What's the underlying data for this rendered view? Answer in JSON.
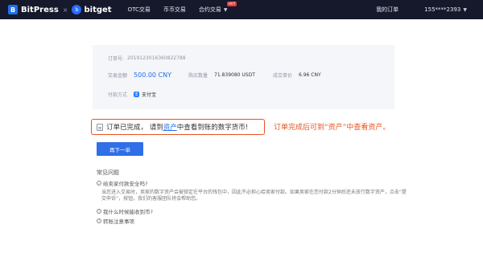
{
  "header": {
    "brand_bitpress": "BitPress",
    "separator": "×",
    "brand_bitget": "bitget",
    "nav": [
      {
        "label": "OTC交易"
      },
      {
        "label": "币币交易"
      },
      {
        "label": "合约交易",
        "badge": "HOT"
      }
    ],
    "my_orders": "我的订单",
    "user": "155****2393"
  },
  "order": {
    "order_no_label": "订单号:",
    "order_no": "2019123016360822788",
    "amount_label": "交易金额",
    "amount": "500.00 CNY",
    "qty_label": "购买数量",
    "qty": "71.839080 USDT",
    "price_label": "成交单价",
    "price": "6.96 CNY",
    "method_label": "付款方式",
    "method": "支付宝"
  },
  "notice": {
    "prefix": "订单已完成， 请到",
    "link": "资产",
    "suffix": "中查看到账的数字货币!"
  },
  "annotation": "订单完成后可到“资产”中查看资产。",
  "next_button": "再下一单",
  "faq": {
    "title": "常见问题",
    "q1": "给卖家付款安全吗?",
    "a1": "当您进入交易时，卖家的数字资产会被锁定在平台的钱包中，因此不必担心给卖家付款。如果卖家在您付款2分钟后还未放行数字资产，点击“提交申诉”，按钮，我们的客服团队将会帮助您。",
    "q2": "我什么时候能收到币?",
    "q3": "转账注意事项"
  }
}
